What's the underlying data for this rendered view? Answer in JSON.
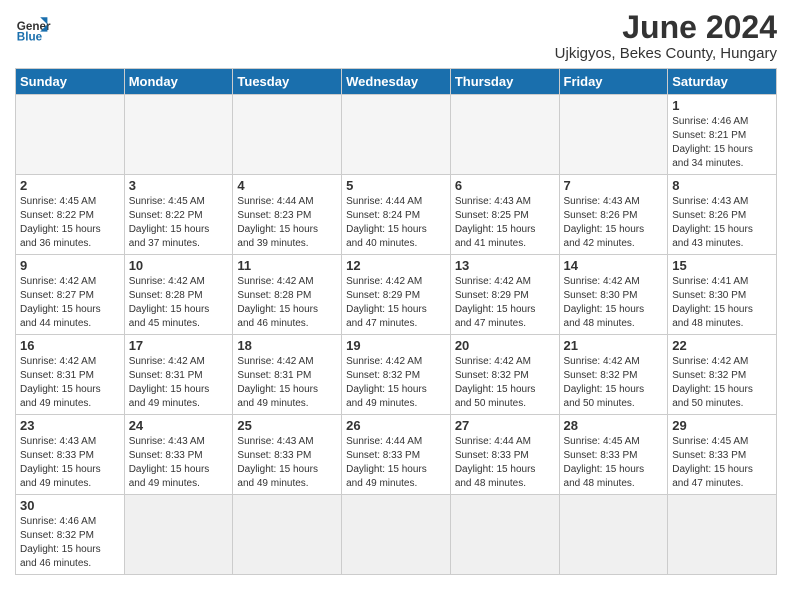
{
  "header": {
    "logo_general": "General",
    "logo_blue": "Blue",
    "title": "June 2024",
    "subtitle": "Ujkigyos, Bekes County, Hungary"
  },
  "days_of_week": [
    "Sunday",
    "Monday",
    "Tuesday",
    "Wednesday",
    "Thursday",
    "Friday",
    "Saturday"
  ],
  "weeks": [
    [
      {
        "day": "",
        "info": "",
        "empty": true
      },
      {
        "day": "",
        "info": "",
        "empty": true
      },
      {
        "day": "",
        "info": "",
        "empty": true
      },
      {
        "day": "",
        "info": "",
        "empty": true
      },
      {
        "day": "",
        "info": "",
        "empty": true
      },
      {
        "day": "",
        "info": "",
        "empty": true
      },
      {
        "day": "1",
        "info": "Sunrise: 4:46 AM\nSunset: 8:21 PM\nDaylight: 15 hours\nand 34 minutes."
      }
    ],
    [
      {
        "day": "2",
        "info": "Sunrise: 4:45 AM\nSunset: 8:22 PM\nDaylight: 15 hours\nand 36 minutes."
      },
      {
        "day": "3",
        "info": "Sunrise: 4:45 AM\nSunset: 8:22 PM\nDaylight: 15 hours\nand 37 minutes."
      },
      {
        "day": "4",
        "info": "Sunrise: 4:44 AM\nSunset: 8:23 PM\nDaylight: 15 hours\nand 39 minutes."
      },
      {
        "day": "5",
        "info": "Sunrise: 4:44 AM\nSunset: 8:24 PM\nDaylight: 15 hours\nand 40 minutes."
      },
      {
        "day": "6",
        "info": "Sunrise: 4:43 AM\nSunset: 8:25 PM\nDaylight: 15 hours\nand 41 minutes."
      },
      {
        "day": "7",
        "info": "Sunrise: 4:43 AM\nSunset: 8:26 PM\nDaylight: 15 hours\nand 42 minutes."
      },
      {
        "day": "8",
        "info": "Sunrise: 4:43 AM\nSunset: 8:26 PM\nDaylight: 15 hours\nand 43 minutes."
      }
    ],
    [
      {
        "day": "9",
        "info": "Sunrise: 4:42 AM\nSunset: 8:27 PM\nDaylight: 15 hours\nand 44 minutes."
      },
      {
        "day": "10",
        "info": "Sunrise: 4:42 AM\nSunset: 8:28 PM\nDaylight: 15 hours\nand 45 minutes."
      },
      {
        "day": "11",
        "info": "Sunrise: 4:42 AM\nSunset: 8:28 PM\nDaylight: 15 hours\nand 46 minutes."
      },
      {
        "day": "12",
        "info": "Sunrise: 4:42 AM\nSunset: 8:29 PM\nDaylight: 15 hours\nand 47 minutes."
      },
      {
        "day": "13",
        "info": "Sunrise: 4:42 AM\nSunset: 8:29 PM\nDaylight: 15 hours\nand 47 minutes."
      },
      {
        "day": "14",
        "info": "Sunrise: 4:42 AM\nSunset: 8:30 PM\nDaylight: 15 hours\nand 48 minutes."
      },
      {
        "day": "15",
        "info": "Sunrise: 4:41 AM\nSunset: 8:30 PM\nDaylight: 15 hours\nand 48 minutes."
      }
    ],
    [
      {
        "day": "16",
        "info": "Sunrise: 4:42 AM\nSunset: 8:31 PM\nDaylight: 15 hours\nand 49 minutes."
      },
      {
        "day": "17",
        "info": "Sunrise: 4:42 AM\nSunset: 8:31 PM\nDaylight: 15 hours\nand 49 minutes."
      },
      {
        "day": "18",
        "info": "Sunrise: 4:42 AM\nSunset: 8:31 PM\nDaylight: 15 hours\nand 49 minutes."
      },
      {
        "day": "19",
        "info": "Sunrise: 4:42 AM\nSunset: 8:32 PM\nDaylight: 15 hours\nand 49 minutes."
      },
      {
        "day": "20",
        "info": "Sunrise: 4:42 AM\nSunset: 8:32 PM\nDaylight: 15 hours\nand 50 minutes."
      },
      {
        "day": "21",
        "info": "Sunrise: 4:42 AM\nSunset: 8:32 PM\nDaylight: 15 hours\nand 50 minutes."
      },
      {
        "day": "22",
        "info": "Sunrise: 4:42 AM\nSunset: 8:32 PM\nDaylight: 15 hours\nand 50 minutes."
      }
    ],
    [
      {
        "day": "23",
        "info": "Sunrise: 4:43 AM\nSunset: 8:33 PM\nDaylight: 15 hours\nand 49 minutes."
      },
      {
        "day": "24",
        "info": "Sunrise: 4:43 AM\nSunset: 8:33 PM\nDaylight: 15 hours\nand 49 minutes."
      },
      {
        "day": "25",
        "info": "Sunrise: 4:43 AM\nSunset: 8:33 PM\nDaylight: 15 hours\nand 49 minutes."
      },
      {
        "day": "26",
        "info": "Sunrise: 4:44 AM\nSunset: 8:33 PM\nDaylight: 15 hours\nand 49 minutes."
      },
      {
        "day": "27",
        "info": "Sunrise: 4:44 AM\nSunset: 8:33 PM\nDaylight: 15 hours\nand 48 minutes."
      },
      {
        "day": "28",
        "info": "Sunrise: 4:45 AM\nSunset: 8:33 PM\nDaylight: 15 hours\nand 48 minutes."
      },
      {
        "day": "29",
        "info": "Sunrise: 4:45 AM\nSunset: 8:33 PM\nDaylight: 15 hours\nand 47 minutes."
      }
    ],
    [
      {
        "day": "30",
        "info": "Sunrise: 4:46 AM\nSunset: 8:32 PM\nDaylight: 15 hours\nand 46 minutes.",
        "last": true
      },
      {
        "day": "",
        "info": "",
        "empty": true,
        "last": true
      },
      {
        "day": "",
        "info": "",
        "empty": true,
        "last": true
      },
      {
        "day": "",
        "info": "",
        "empty": true,
        "last": true
      },
      {
        "day": "",
        "info": "",
        "empty": true,
        "last": true
      },
      {
        "day": "",
        "info": "",
        "empty": true,
        "last": true
      },
      {
        "day": "",
        "info": "",
        "empty": true,
        "last": true
      }
    ]
  ]
}
